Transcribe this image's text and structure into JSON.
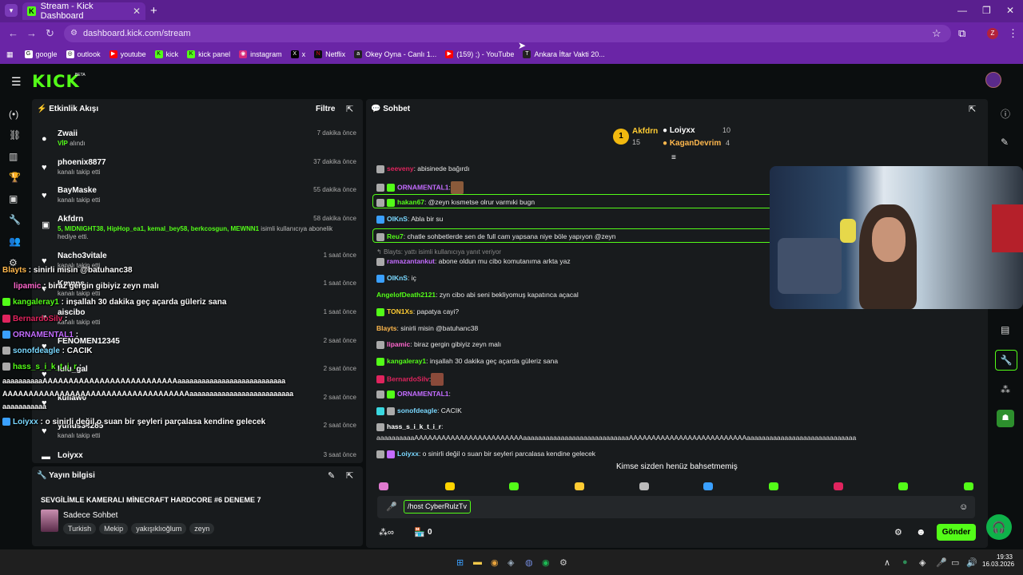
{
  "browser": {
    "tab_title": "Stream - Kick Dashboard",
    "url": "dashboard.kick.com/stream",
    "bookmarks": [
      "google",
      "outlook",
      "youtube",
      "kick",
      "kick panel",
      "instagram",
      "x",
      "Netflix",
      "Okey Oyna - Canlı 1...",
      "(159) ;) - YouTube",
      "Ankara İftar Vakti 20..."
    ]
  },
  "app": {
    "logo": "KICK",
    "beta": "BETA"
  },
  "activity": {
    "title": "Etkinlik Akışı",
    "filter": "Filtre",
    "items": [
      {
        "name": "Zwaii",
        "sub_hl": "VİP",
        "sub": " alındı",
        "time": "7 dakika önce",
        "icon": "users-icon"
      },
      {
        "name": "phoenix8877",
        "sub": "kanalı takip etti",
        "time": "37 dakika önce",
        "icon": "heart-icon"
      },
      {
        "name": "BayMaske",
        "sub": "kanalı takip etti",
        "time": "55 dakika önce",
        "icon": "heart-icon"
      },
      {
        "name": "Akfdrn",
        "sub_hl": "5, MIDNIGHT38, HipHop_ea1, kemal_bey58, berkcosgun, MEWNN1",
        "sub": " isimli kullanıcıya abonelik hediye etti.",
        "time": "58 dakika önce",
        "icon": "gift-icon"
      },
      {
        "name": "Nacho3vitale",
        "sub": "kanalı takip etti",
        "time": "1 saat önce",
        "icon": "heart-icon"
      },
      {
        "name": "Kmnns",
        "sub": "kanalı takip etti",
        "time": "1 saat önce",
        "icon": "heart-icon"
      },
      {
        "name": "aiscibo",
        "sub": "kanalı takip etti",
        "time": "1 saat önce",
        "icon": "heart-icon"
      },
      {
        "name": "FENOMEN12345",
        "sub": "",
        "time": "2 saat önce",
        "icon": "heart-icon"
      },
      {
        "name": "lulu_gal",
        "sub": "",
        "time": "2 saat önce",
        "icon": "heart-icon"
      },
      {
        "name": "kullaw0",
        "sub": "",
        "time": "2 saat önce",
        "icon": "heart-icon"
      },
      {
        "name": "yunus34285",
        "sub": "kanalı takip etti",
        "time": "2 saat önce",
        "icon": "heart-icon"
      },
      {
        "name": "Loiyxx",
        "sub": "",
        "time": "3 saat önce",
        "icon": "gift-icon"
      }
    ]
  },
  "stream_info": {
    "title": "Yayın bilgisi",
    "stream_title": "SEVGİLİMLE KAMERALI MİNECRAFT HARDCORE #6 DENEME 7",
    "category": "Sadece Sohbet",
    "tags": [
      "Turkish",
      "Mekip",
      "yakışıklıoğlum",
      "zeyn"
    ]
  },
  "chat": {
    "title": "Sohbet",
    "leaderboard": {
      "first": "Akfdrn",
      "first_count": "15",
      "second": "Loiyxx",
      "second_count": "10",
      "third": "KaganDevrim",
      "third_count": "4",
      "rank": "1"
    },
    "messages": [
      {
        "user": "seeveny",
        "color": "#e0245e",
        "text": ": abisinede bağırdı"
      },
      {
        "user": "ORNAMENTAL1",
        "color": "#c36cff",
        "text": ":"
      },
      {
        "user": "hakan67",
        "color": "#53fc18",
        "text": ": @zeyn kısmetse olrur varmıki bugn"
      },
      {
        "user": "OIKnS",
        "color": "#7ad8ff",
        "text": ": Abla bir su"
      },
      {
        "user": "Reu7",
        "color": "#53fc18",
        "text": ": chatle sohbetlerde sen de full cam yapsana niye böle yapıyon @zeyn"
      },
      {
        "user": "ramazantankut",
        "color": "#c36cff",
        "text": ": abone oldun mu cibo komutanıma arkta yaz"
      },
      {
        "user": "OIKnS",
        "color": "#7ad8ff",
        "text": ": iç"
      },
      {
        "user": "AngelofDeath2121",
        "color": "#53fc18",
        "text": ": zyn cibo abi seni bekliyomuş kapatınca açacal"
      },
      {
        "user": "TON1Xs",
        "color": "#ffcc33",
        "text": ": papatya cayi?"
      },
      {
        "user": "Blayts",
        "color": "#ffb84d",
        "text": ": sinirli misin @batuhanc38"
      },
      {
        "user": "lipamic",
        "color": "#ff66cc",
        "text": ": biraz gergin gibiyiz zeyn malı"
      },
      {
        "user": "kangaleray1",
        "color": "#53fc18",
        "text": ": inşallah 30 dakika geç açarda güleriz sana"
      },
      {
        "user": "BernardoSilv",
        "color": "#e0245e",
        "text": ":"
      },
      {
        "user": "ORNAMENTAL1",
        "color": "#c36cff",
        "text": ":"
      },
      {
        "user": "sonofdeagle",
        "color": "#7ad8ff",
        "text": ": CACIK"
      },
      {
        "user": "hass_s_i_k_t_i_r",
        "color": "#ffffff",
        "text": ":"
      },
      {
        "user": "",
        "color": "#ffffff",
        "text": "aaaaaaaaaaAAAAAAAAAAAAAAAAAAAAAAAAaaaaaaaaaaaaaaaaaaaaaaaaaaaaAAAAAAAAAAAAAAAAAAAAAAAAAAaaaaaaaaaaaaaaaaaaaaaaaaaaaaa"
      },
      {
        "user": "Loiyxx",
        "color": "#7ad8ff",
        "text": ": o sinirli değil o suan bir seyleri parcalasa kendine gelecek"
      }
    ],
    "reply_hint": "Blayts: yattı isimli kullanıcıya yanıt veriyor",
    "mention_notice": "Kimse sizden henüz bahsetmemiş",
    "input_value": "/host CyberRulzTv",
    "points": "0",
    "send_label": "Gönder"
  },
  "overlay": [
    {
      "user": "Blayts",
      "color": "#ffb84d",
      "text": " : sinirli misin @batuhanc38"
    },
    {
      "user": "lipamic",
      "color": "#ff66cc",
      "text": " : biraz gergin gibiyiz zeyn malı"
    },
    {
      "user": "kangaleray1",
      "color": "#53fc18",
      "text": " : inşallah 30 dakika geç açarda güleriz sana"
    },
    {
      "user": "BernardoSilv",
      "color": "#e0245e",
      "text": " :"
    },
    {
      "user": "ORNAMENTAL1",
      "color": "#c36cff",
      "text": " :"
    },
    {
      "user": "sonofdeagle",
      "color": "#7ad8ff",
      "text": " : CACIK"
    },
    {
      "user": "hass_s_i_k_t_i_r",
      "color": "#53fc18",
      "text": " :"
    },
    {
      "user": "",
      "color": "#ffffff",
      "text": "aaaaaaaaaaAAAAAAAAAAAAAAAAAAAAAAAAAAaaaaaaaaaaaaaaaaaaaaaaaaaaa"
    },
    {
      "user": "",
      "color": "#ffffff",
      "text": "AAAAAAAAAAAAAAAAAAAAAAAAAAAAAAAAAAAAaaaaaaaaaaaaaaaaaaaaaaaaaa"
    },
    {
      "user": "",
      "color": "#ffffff",
      "text": "aaaaaaaaaaa"
    },
    {
      "user": "Loiyxx",
      "color": "#7ad8ff",
      "text": " : o sinirli değil o suan bir şeyleri parçalasa kendine gelecek"
    }
  ],
  "taskbar": {
    "time": "19:33",
    "date": "16.03.2026"
  }
}
